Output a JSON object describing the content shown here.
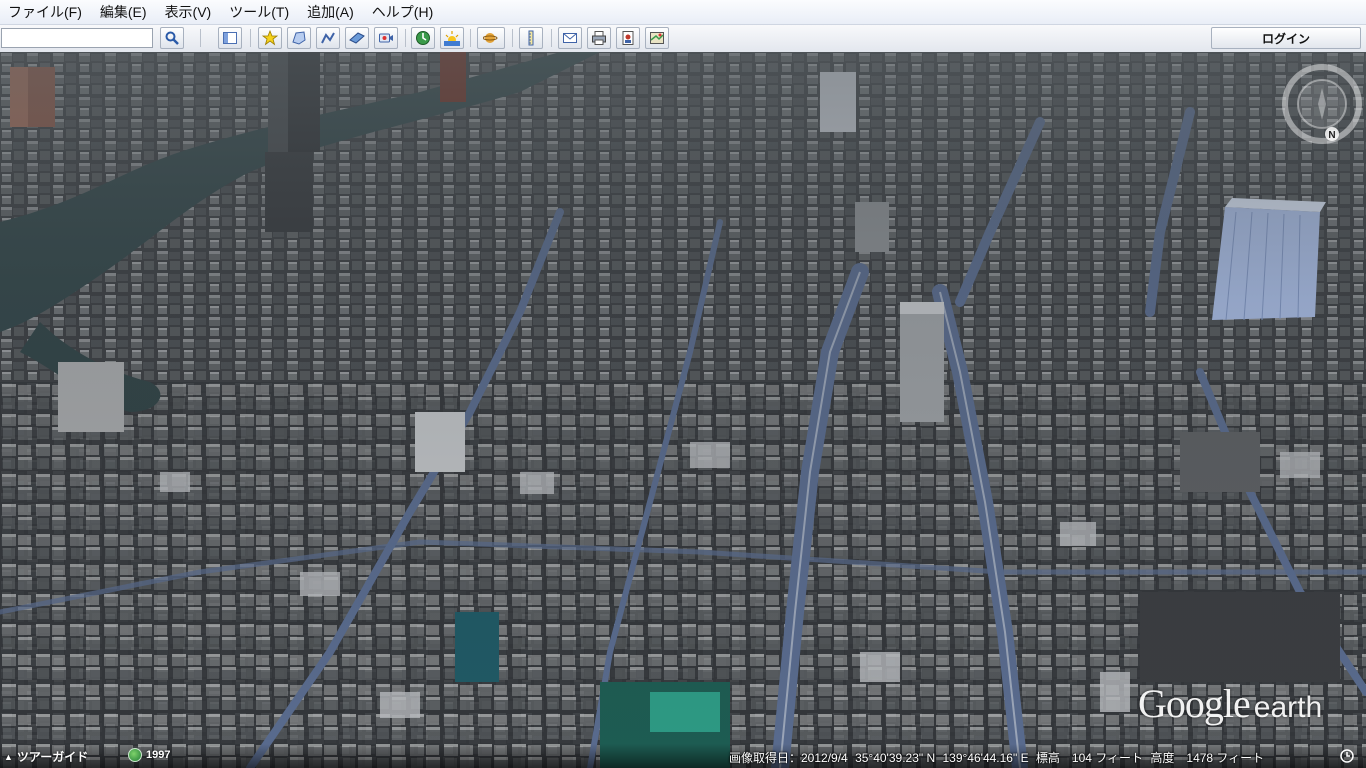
{
  "menubar": {
    "items": [
      {
        "label": "ファイル(F)"
      },
      {
        "label": "編集(E)"
      },
      {
        "label": "表示(V)"
      },
      {
        "label": "ツール(T)"
      },
      {
        "label": "追加(A)"
      },
      {
        "label": "ヘルプ(H)"
      }
    ]
  },
  "toolbar": {
    "search_value": "",
    "login_label": "ログイン",
    "buttons": [
      {
        "icon": "search-icon"
      },
      {
        "icon": "sidebar-toggle-icon"
      },
      {
        "icon": "add-placemark-icon"
      },
      {
        "icon": "add-polygon-icon"
      },
      {
        "icon": "add-path-icon"
      },
      {
        "icon": "add-image-overlay-icon"
      },
      {
        "icon": "record-tour-icon"
      },
      {
        "icon": "historical-imagery-icon"
      },
      {
        "icon": "sunlight-icon"
      },
      {
        "icon": "planet-switch-icon"
      },
      {
        "icon": "ruler-icon"
      },
      {
        "icon": "email-icon"
      },
      {
        "icon": "print-icon"
      },
      {
        "icon": "save-image-icon"
      },
      {
        "icon": "view-in-maps-icon"
      }
    ]
  },
  "statusbar": {
    "tour_guide_label": "ツアーガイド",
    "history_year": "1997",
    "imagery_date": "画像取得日：2012/9/4",
    "latitude": "35°40'39.23\" N",
    "longitude": "139°46'44.16\" E",
    "elevation": "標高　104 フィート",
    "eye_altitude": "高度　1478 フィート"
  },
  "logo": {
    "brand": "Google",
    "product": "earth"
  },
  "colors": {
    "menubar_bg": "#eef2f9",
    "toolbar_bg": "#e8ecf2",
    "water": "#314548",
    "highlight_building": "#a9bde6",
    "status_text": "#ffffff"
  }
}
